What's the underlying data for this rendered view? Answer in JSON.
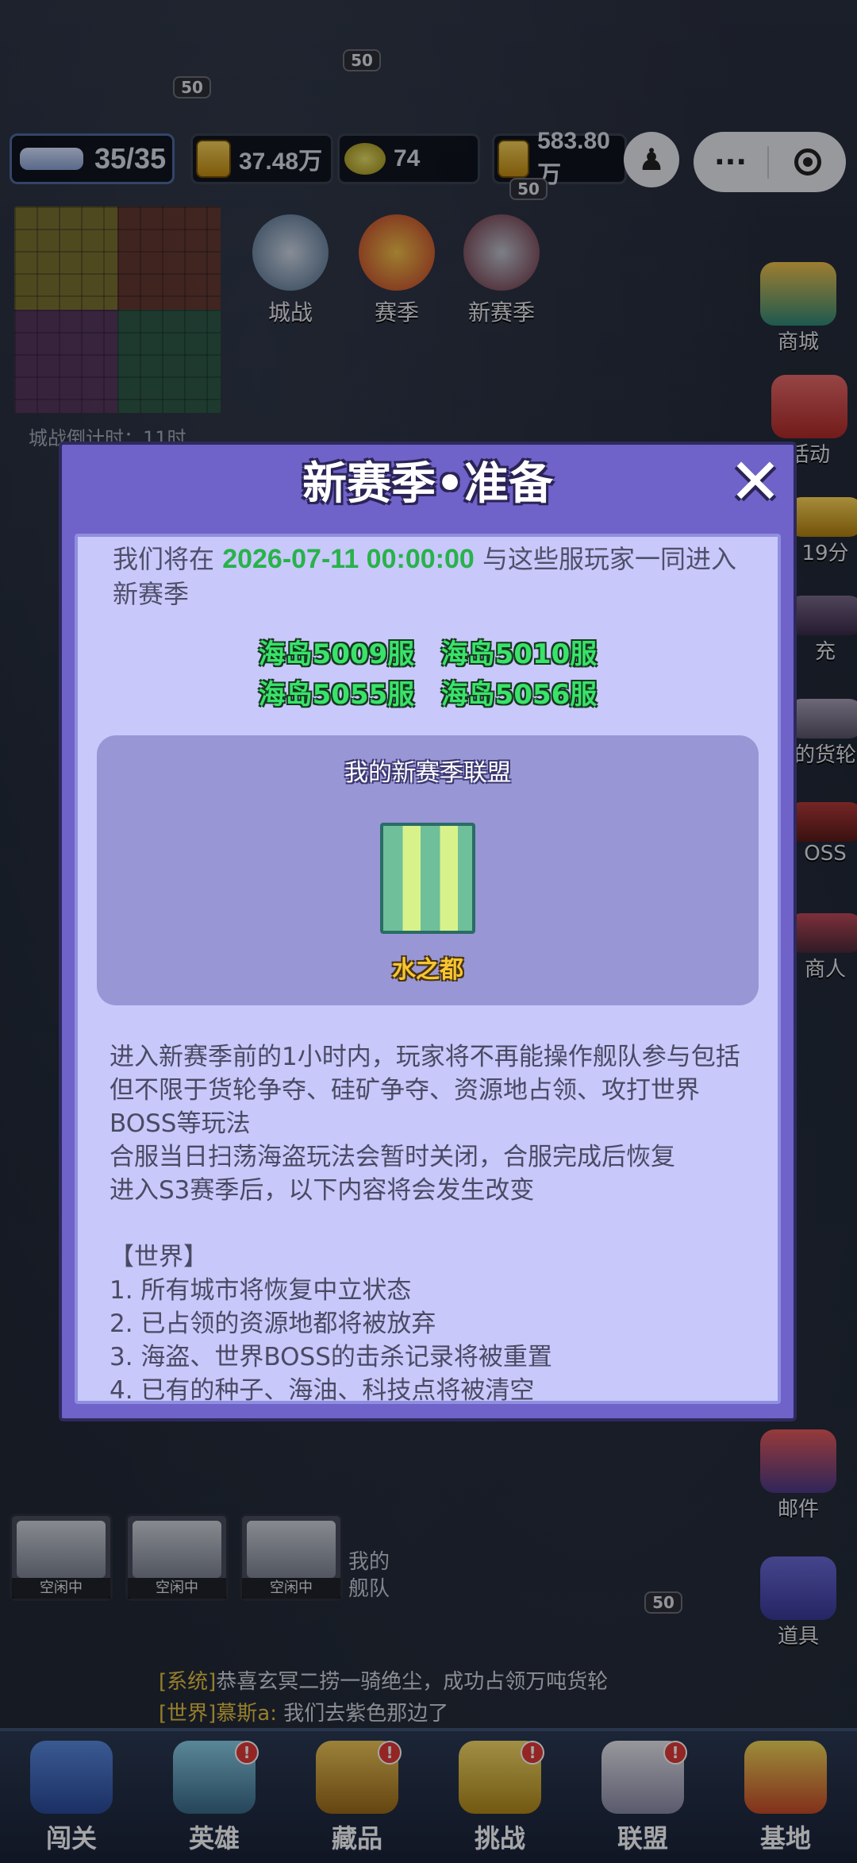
{
  "hud": {
    "ships": "35/35",
    "gold": "37.48万",
    "coins": "74",
    "resource": "583.80万"
  },
  "capsule": {
    "more": "···"
  },
  "map": {
    "countdown": "城战倒计时：11时"
  },
  "top_icons": [
    "城战",
    "赛季",
    "新赛季"
  ],
  "side_icons": {
    "shop": "商城",
    "activity": "活动",
    "timer": "19分",
    "charge": "充",
    "cargo": "的货轮",
    "boss": "OSS",
    "merchant": "商人",
    "mail": "邮件",
    "items": "道具"
  },
  "ship_badges": [
    "50",
    "50",
    "50",
    "50"
  ],
  "fleet": {
    "slots": [
      "空闲中",
      "空闲中",
      "空闲中"
    ],
    "label": "我的舰队"
  },
  "chat": [
    {
      "channel": "[系统]",
      "text": "恭喜玄冥二捞一骑绝尘，成功占领万吨货轮"
    },
    {
      "channel": "[世界]慕斯a:",
      "text": "我们去紫色那边了"
    }
  ],
  "nav": [
    {
      "label": "闯关",
      "badge": ""
    },
    {
      "label": "英雄",
      "badge": "!"
    },
    {
      "label": "藏品",
      "badge": "!"
    },
    {
      "label": "挑战",
      "badge": "!"
    },
    {
      "label": "联盟",
      "badge": "!"
    },
    {
      "label": "基地",
      "badge": ""
    }
  ],
  "modal": {
    "title": "新赛季•准备",
    "close": "✕",
    "intro_before": "我们将在 ",
    "intro_date": "2026-07-11 00:00:00",
    "intro_after": " 与这些服玩家一同进入新赛季",
    "servers": [
      "海岛5009服",
      "海岛5010服",
      "海岛5055服",
      "海岛5056服"
    ],
    "alliance_title": "我的新赛季联盟",
    "alliance_name": "水之都",
    "notes": [
      "进入新赛季前的1小时内，玩家将不再能操作舰队参与包括但不限于货轮争夺、硅矿争夺、资源地占领、攻打世界BOSS等玩法",
      "合服当日扫荡海盗玩法会暂时关闭，合服完成后恢复",
      "进入S3赛季后，以下内容将会发生改变",
      "",
      "【世界】",
      "1. 所有城市将恢复中立状态",
      "2. 已占领的资源地都将被放弃",
      "3. 海盗、世界BOSS的击杀记录将被重置",
      "4. 已有的种子、海油、科技点将被清空"
    ]
  },
  "colors": {
    "modal_frame": "#6f62c9",
    "modal_body": "#c8c8fb",
    "date_green": "#28b24a",
    "server_green": "#39e36a",
    "alliance_gold": "#f6c531"
  }
}
